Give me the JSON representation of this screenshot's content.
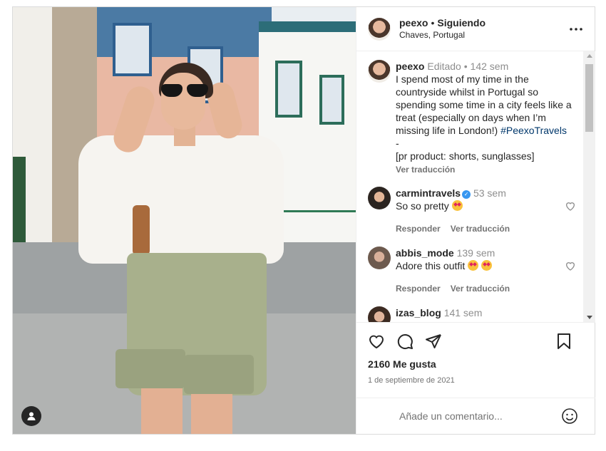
{
  "post": {
    "username": "peexo",
    "follow_label": "Siguiendo",
    "location": "Chaves, Portugal",
    "caption": {
      "username": "peexo",
      "edited": "Editado",
      "age": "142 sem",
      "text": "I spend most of my time in the countryside whilst in Portugal so spending some time in a city feels like a treat (especially on days when I’m missing life in London!)",
      "hashtag": "#PeexoTravels",
      "dash": "-",
      "pr": "[pr product: shorts, sunglasses]",
      "translate": "Ver traducción"
    },
    "comments": [
      {
        "username": "carmintravels",
        "verified": true,
        "age": "53 sem",
        "text": "So so pretty",
        "reply": "Responder",
        "translate": "Ver traducción"
      },
      {
        "username": "abbis_mode",
        "verified": false,
        "age": "139 sem",
        "text": "Adore this outfit",
        "reply": "Responder",
        "translate": "Ver traducción"
      },
      {
        "username": "izas_blog",
        "verified": false,
        "age": "141 sem"
      }
    ],
    "likes": "2160 Me gusta",
    "date": "1 de septiembre de 2021",
    "comment_placeholder": "Añade un comentario..."
  },
  "colors": {
    "hashtag": "#00376b",
    "verified": "#3897f0",
    "muted": "#737373"
  }
}
